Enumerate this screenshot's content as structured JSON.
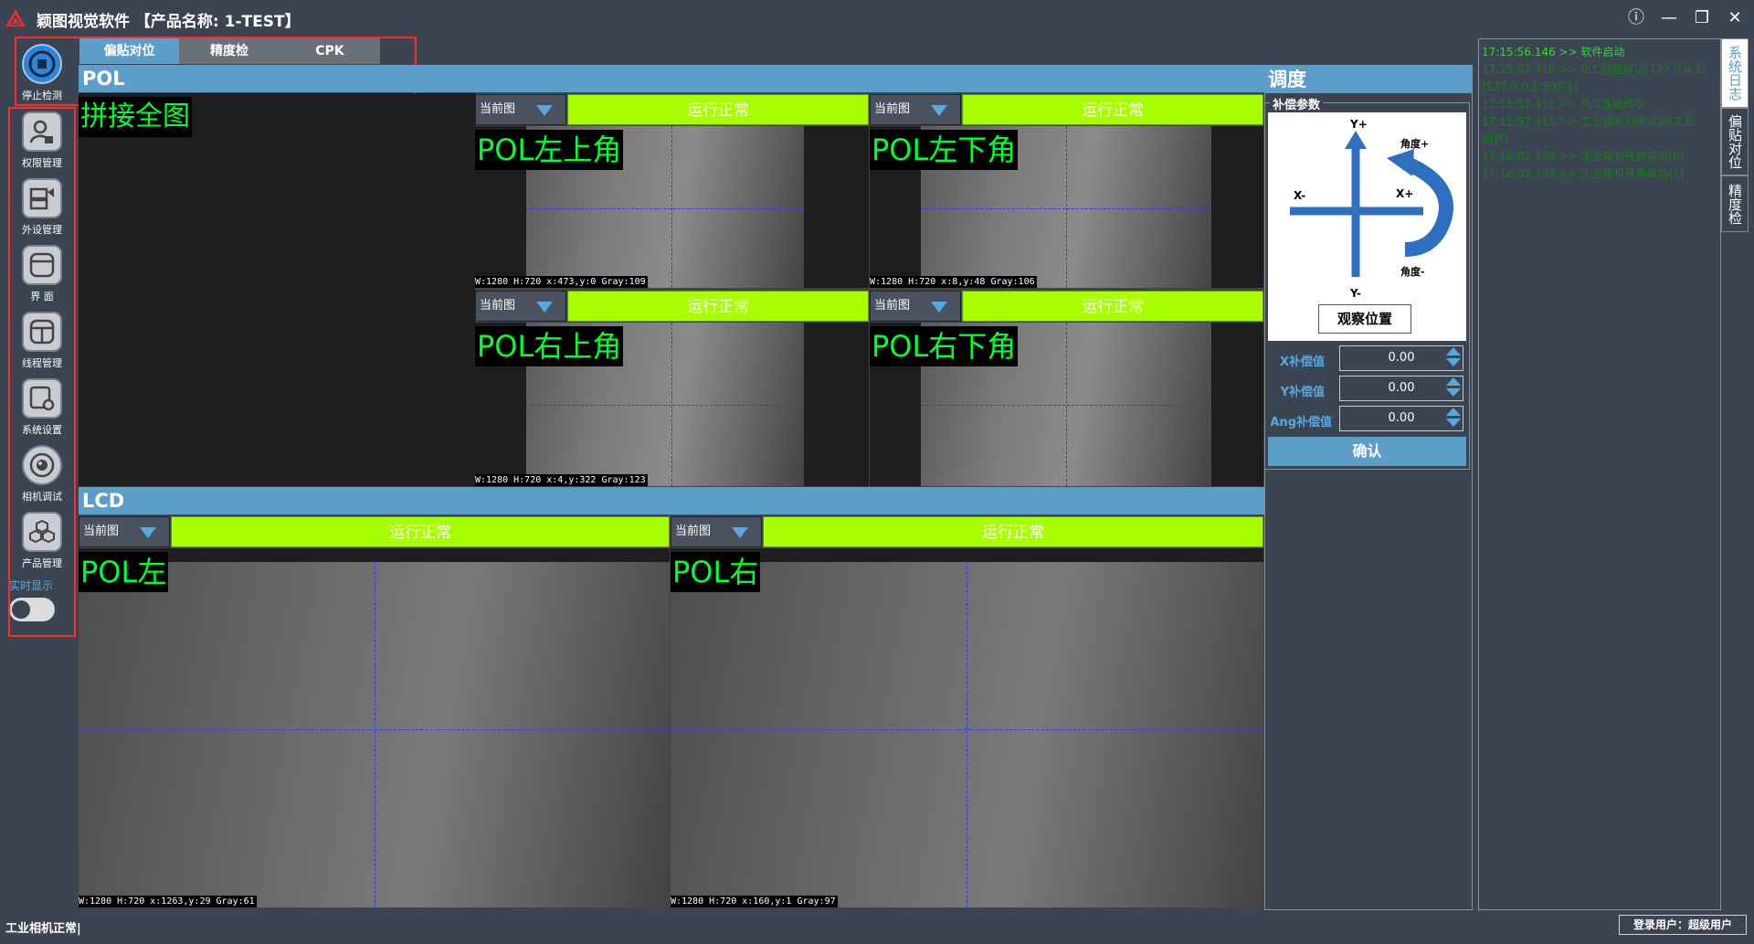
{
  "window": {
    "title": "颖图视觉软件 【产品名称: 1-TEST】",
    "info_icon": "info-icon",
    "min_icon": "minimize-icon",
    "max_icon": "restore-icon",
    "close_icon": "close-icon",
    "info_glyph": "ⓘ",
    "min_glyph": "—",
    "restore_glyph": "❐",
    "close_glyph": "✕"
  },
  "sidebar": {
    "items": [
      {
        "label": "停止检测",
        "icon": "stop-icon"
      },
      {
        "label": "权限管理",
        "icon": "user-lock-icon"
      },
      {
        "label": "外设管理",
        "icon": "peripheral-icon"
      },
      {
        "label": "界 面",
        "icon": "window-icon"
      },
      {
        "label": "线程管理",
        "icon": "thread-icon"
      },
      {
        "label": "系统设置",
        "icon": "settings-icon"
      },
      {
        "label": "相机调试",
        "icon": "camera-icon"
      },
      {
        "label": "产品管理",
        "icon": "product-cubes-icon"
      }
    ],
    "realtime_label": "实时显示"
  },
  "tabs": [
    {
      "label": "偏贴对位",
      "active": true
    },
    {
      "label": "精度检",
      "active": false
    },
    {
      "label": "CPK",
      "active": false
    }
  ],
  "pol": {
    "header": "POL",
    "stitch_label": "拼接全图",
    "cams": [
      {
        "dropdown": "当前图",
        "status": "运行正常",
        "label": "POL左上角",
        "info": "W:1280 H:720 x:473,y:0 Gray:109"
      },
      {
        "dropdown": "当前图",
        "status": "运行正常",
        "label": "POL左下角",
        "info": "W:1280 H:720 x:8,y:48 Gray:106"
      },
      {
        "dropdown": "当前图",
        "status": "运行正常",
        "label": "POL右上角",
        "info": "W:1280 H:720 x:4,y:322 Gray:123"
      },
      {
        "dropdown": "当前图",
        "status": "运行正常",
        "label": "POL右下角",
        "info": ""
      }
    ]
  },
  "lcd": {
    "header": "LCD",
    "cams": [
      {
        "dropdown": "当前图",
        "status": "运行正常",
        "label": "POL左",
        "info": "W:1280 H:720 x:1263,y:29 Gray:61"
      },
      {
        "dropdown": "当前图",
        "status": "运行正常",
        "label": "POL右",
        "info": "W:1280 H:720 x:160,y:1 Gray:97"
      }
    ]
  },
  "adjust": {
    "header": "调度",
    "group_title": "补偿参数",
    "diagram": {
      "y_plus": "Y+",
      "y_minus": "Y-",
      "x_minus": "X-",
      "x_plus": "X+",
      "angle_plus": "角度+",
      "angle_minus": "角度-"
    },
    "observe_button": "观察位置",
    "fields": [
      {
        "label": "X补偿值",
        "value": "0.00"
      },
      {
        "label": "Y补偿值",
        "value": "0.00"
      },
      {
        "label": "Ang补偿值",
        "value": "0.00"
      }
    ],
    "confirm_button": "确认",
    "colors": {
      "arrow": "#2f6fc0",
      "accent": "#5b9ec9"
    }
  },
  "log": {
    "lines": [
      {
        "text": "17:15:56.146 >> 软件启动",
        "dim": false
      },
      {
        "text": "17:15:57.410 >> PLC创建成功(127.0.0.1)",
        "dim": true
      },
      {
        "text": "17:15:57.411 >> PLC连接成功",
        "dim": true
      },
      {
        "text": "17:15:57.411 >> 工业相机创建成功(工业",
        "dim": true
      },
      {
        "text": "相机)",
        "dim": true
      },
      {
        "text": "17:16:02.188 >> 工业相机开启成功(0)",
        "dim": true
      },
      {
        "text": "17:16:02.189 >> 工业相机开启成功(1)",
        "dim": true
      }
    ],
    "first_line_end": "(127.0.0.1:502-1)",
    "side_tabs": [
      "系统日志",
      "偏贴对位",
      "精度检"
    ]
  },
  "statusbar": {
    "left": "工业相机正常|",
    "user": "登录用户：超级用户"
  },
  "colors": {
    "bg": "#3b4451",
    "status_green": "#a8ff00",
    "label_green": "#00ff33",
    "header_blue": "#5b9ec9",
    "frame_red": "#ff2a2a"
  }
}
